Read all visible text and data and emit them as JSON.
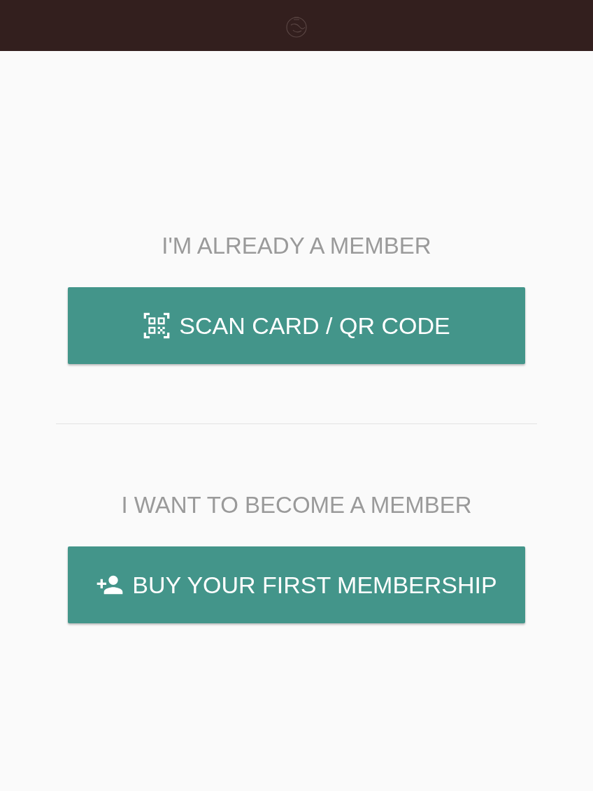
{
  "sections": [
    {
      "heading": "I'M ALREADY A MEMBER",
      "button": {
        "label": "SCAN CARD / QR CODE",
        "kind": "qr"
      }
    },
    {
      "heading": "I WANT TO BECOME A MEMBER",
      "button": {
        "label": "BUY YOUR FIRST MEMBERSHIP",
        "kind": "add-person"
      }
    }
  ]
}
